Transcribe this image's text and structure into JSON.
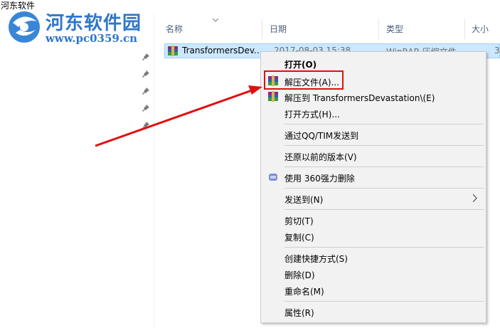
{
  "window": {
    "title": "河东软件"
  },
  "watermark": {
    "name": "河东软件园",
    "url": "www.pc0359.cn"
  },
  "columns": {
    "name": "名称",
    "date": "日期",
    "type": "类型",
    "size": "大小"
  },
  "file": {
    "name": "TransformersDev...",
    "date": "2017-08-03 15:38",
    "type": "WinRAR 压缩文件",
    "size": "3"
  },
  "context_menu": {
    "open": "打开(O)",
    "extract_files": "解压文件(A)...",
    "extract_to": "解压到 TransformersDevastation\\(E)",
    "open_with": "打开方式(H)...",
    "send_qq": "通过QQ/TIM发送到",
    "restore_previous": "还原以前的版本(V)",
    "force_delete": "使用 360强力删除",
    "send_to": "发送到(N)",
    "cut": "剪切(T)",
    "copy": "复制(C)",
    "create_shortcut": "创建快捷方式(S)",
    "delete": "删除(D)",
    "rename": "重命名(M)",
    "properties": "属性(R)"
  },
  "colors": {
    "highlight": "#e01010",
    "selection": "#cce8ff",
    "watermark": "#2f76c8"
  },
  "icons": [
    "winrar-icon",
    "pin-icon",
    "shield-360-icon",
    "chevron-right-icon",
    "sort-chevron-icon"
  ]
}
